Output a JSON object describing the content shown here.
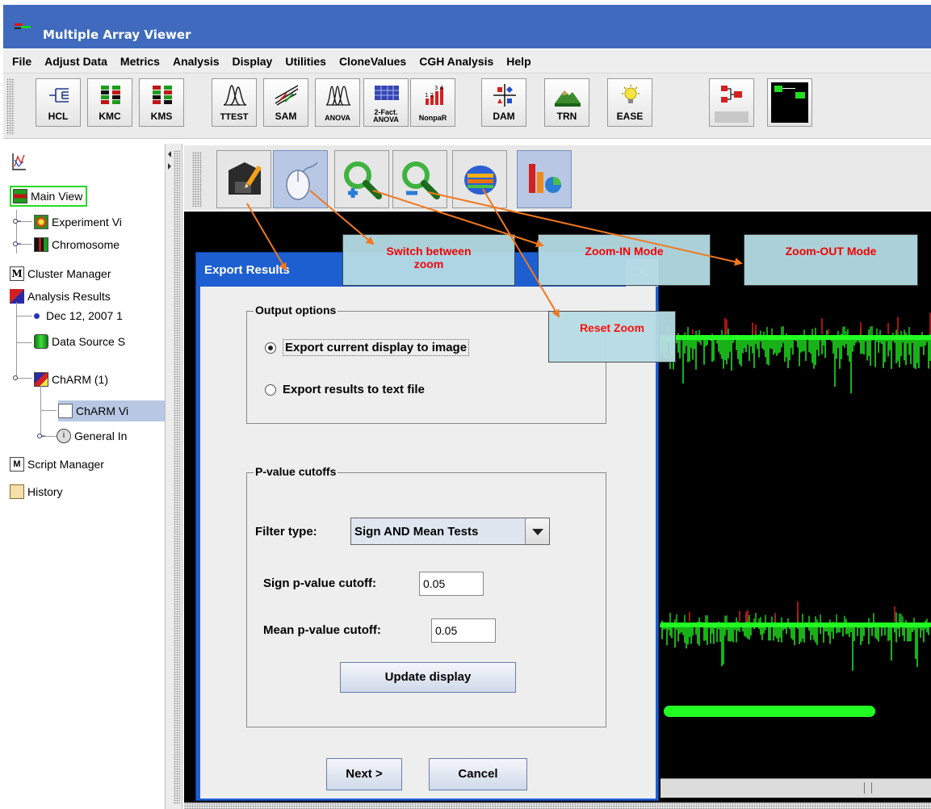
{
  "window": {
    "title": "Multiple Array Viewer"
  },
  "menu": [
    "File",
    "Adjust Data",
    "Metrics",
    "Analysis",
    "Display",
    "Utilities",
    "CloneValues",
    "CGH Analysis",
    "Help"
  ],
  "toolbar": {
    "buttons": [
      {
        "label": "HCL",
        "icon": "hcl-dendrogram-icon"
      },
      {
        "label": "KMC",
        "icon": "kmc-grid-icon"
      },
      {
        "label": "KMS",
        "icon": "kms-grid-icon"
      },
      {
        "label": "TTEST",
        "icon": "ttest-peaks-icon"
      },
      {
        "label": "SAM",
        "icon": "sam-scatter-icon"
      },
      {
        "label": "ANOVA",
        "icon": "anova-peaks-icon"
      },
      {
        "label": "2-Fact.\nANOVA",
        "icon": "two-factor-anova-icon"
      },
      {
        "label": "NonpaR",
        "icon": "nonpar-bars-icon"
      },
      {
        "label": "DAM",
        "icon": "dam-icon"
      },
      {
        "label": "TRN",
        "icon": "trn-mountain-icon"
      },
      {
        "label": "EASE",
        "icon": "ease-bulb-icon"
      },
      {
        "label": "",
        "icon": "network-icon"
      },
      {
        "label": "",
        "icon": "tree-diagram-icon"
      }
    ]
  },
  "tree": {
    "main_view": "Main View",
    "experiment_viewer": "Experiment Vi",
    "chromosome": "Chromosome",
    "cluster_manager": "Cluster Manager",
    "analysis_results": "Analysis Results",
    "analysis_date": "Dec 12, 2007 1",
    "data_source": "Data Source S",
    "charm": "ChARM (1)",
    "charm_viewer": "ChARM Vi",
    "general_info": "General In",
    "script_manager": "Script Manager",
    "history": "History"
  },
  "display_toolbar": {
    "buttons": [
      "save-icon",
      "mouse-icon",
      "zoom-in-icon",
      "zoom-out-icon",
      "reset-zoom-icon",
      "chart-icon"
    ]
  },
  "dialog": {
    "title": "Export Results",
    "output_options": {
      "title": "Output options",
      "export_image": "Export current display to image",
      "export_text": "Export results to text file",
      "selected": "image"
    },
    "pvalue": {
      "title": "P-value cutoffs",
      "filter_label": "Filter type:",
      "filter_value": "Sign AND Mean Tests",
      "sign_label": "Sign p-value cutoff:",
      "sign_value": "0.05",
      "mean_label": "Mean  p-value cutoff:",
      "mean_value": "0.05",
      "update_button": "Update display"
    },
    "next_button": "Next >",
    "cancel_button": "Cancel"
  },
  "callouts": {
    "switch_zoom": "Switch between\nzoom",
    "zoom_in": "Zoom-IN  Mode",
    "zoom_out": "Zoom-OUT  Mode",
    "reset_zoom": "Reset Zoom"
  },
  "colors": {
    "title_bar": "#3f6abd",
    "dialog_title": "#1d5fd1",
    "callout_bg": "#b7dde5",
    "callout_text": "#ff0000",
    "arrow": "#f07820",
    "signal_green": "#22ff22",
    "signal_red": "#ff2020"
  }
}
